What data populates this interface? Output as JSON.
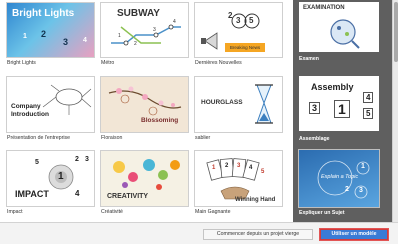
{
  "templates": [
    {
      "caption": "Bright Lights",
      "title": "Bright Lights",
      "numbers": [
        "1",
        "2",
        "3",
        "4"
      ]
    },
    {
      "caption": "Métro",
      "title": "SUBWAY",
      "numbers": [
        "1",
        "2",
        "3",
        "4"
      ]
    },
    {
      "caption": "Dernières Nouvelles",
      "numbers": [
        "2",
        "3",
        "5"
      ],
      "badge": "Breaking News"
    },
    {
      "caption": "Présentation de l'entreprise",
      "title": "Company Introduction"
    },
    {
      "caption": "Floraison",
      "title": "Blossoming"
    },
    {
      "caption": "sablier",
      "title": "HOURGLASS"
    },
    {
      "caption": "Impact",
      "title": "IMPACT",
      "numbers": [
        "1",
        "2",
        "3",
        "4",
        "5"
      ]
    },
    {
      "caption": "Créativité",
      "title": "CREATIVITY"
    },
    {
      "caption": "Main Gagnante",
      "title": "Winning Hand",
      "numbers": [
        "1",
        "2",
        "3",
        "4",
        "5"
      ]
    }
  ],
  "side_templates": [
    {
      "caption": "Examen",
      "title": "EXAMINATION"
    },
    {
      "caption": "Assemblage",
      "title": "Assembly",
      "numbers": [
        "1",
        "3",
        "4",
        "5"
      ]
    },
    {
      "caption": "Expliquer un Sujet",
      "title": "Explain a Topic",
      "numbers": [
        "1",
        "2",
        "3"
      ]
    }
  ],
  "footer": {
    "blank_button": "Commencer depuis un projet vierge",
    "use_button": "Utiliser un modèle"
  },
  "colors": {
    "primary_button": "#3a7bd5",
    "selection_outline": "#e25555",
    "side_panel": "#5f5f5f"
  }
}
